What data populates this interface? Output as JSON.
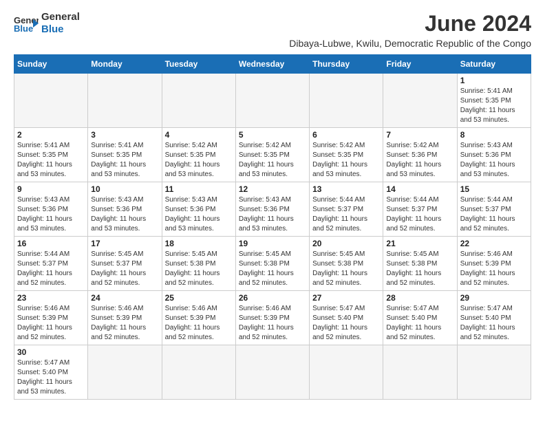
{
  "header": {
    "logo_general": "General",
    "logo_blue": "Blue",
    "month_year": "June 2024",
    "location": "Dibaya-Lubwe, Kwilu, Democratic Republic of the Congo"
  },
  "weekdays": [
    "Sunday",
    "Monday",
    "Tuesday",
    "Wednesday",
    "Thursday",
    "Friday",
    "Saturday"
  ],
  "weeks": [
    [
      {
        "day": "",
        "info": "",
        "empty": true
      },
      {
        "day": "",
        "info": "",
        "empty": true
      },
      {
        "day": "",
        "info": "",
        "empty": true
      },
      {
        "day": "",
        "info": "",
        "empty": true
      },
      {
        "day": "",
        "info": "",
        "empty": true
      },
      {
        "day": "",
        "info": "",
        "empty": true
      },
      {
        "day": "1",
        "info": "Sunrise: 5:41 AM\nSunset: 5:35 PM\nDaylight: 11 hours\nand 53 minutes.",
        "empty": false
      }
    ],
    [
      {
        "day": "2",
        "info": "Sunrise: 5:41 AM\nSunset: 5:35 PM\nDaylight: 11 hours\nand 53 minutes.",
        "empty": false
      },
      {
        "day": "3",
        "info": "Sunrise: 5:41 AM\nSunset: 5:35 PM\nDaylight: 11 hours\nand 53 minutes.",
        "empty": false
      },
      {
        "day": "4",
        "info": "Sunrise: 5:42 AM\nSunset: 5:35 PM\nDaylight: 11 hours\nand 53 minutes.",
        "empty": false
      },
      {
        "day": "5",
        "info": "Sunrise: 5:42 AM\nSunset: 5:35 PM\nDaylight: 11 hours\nand 53 minutes.",
        "empty": false
      },
      {
        "day": "6",
        "info": "Sunrise: 5:42 AM\nSunset: 5:35 PM\nDaylight: 11 hours\nand 53 minutes.",
        "empty": false
      },
      {
        "day": "7",
        "info": "Sunrise: 5:42 AM\nSunset: 5:36 PM\nDaylight: 11 hours\nand 53 minutes.",
        "empty": false
      },
      {
        "day": "8",
        "info": "Sunrise: 5:43 AM\nSunset: 5:36 PM\nDaylight: 11 hours\nand 53 minutes.",
        "empty": false
      }
    ],
    [
      {
        "day": "9",
        "info": "Sunrise: 5:43 AM\nSunset: 5:36 PM\nDaylight: 11 hours\nand 53 minutes.",
        "empty": false
      },
      {
        "day": "10",
        "info": "Sunrise: 5:43 AM\nSunset: 5:36 PM\nDaylight: 11 hours\nand 53 minutes.",
        "empty": false
      },
      {
        "day": "11",
        "info": "Sunrise: 5:43 AM\nSunset: 5:36 PM\nDaylight: 11 hours\nand 53 minutes.",
        "empty": false
      },
      {
        "day": "12",
        "info": "Sunrise: 5:43 AM\nSunset: 5:36 PM\nDaylight: 11 hours\nand 53 minutes.",
        "empty": false
      },
      {
        "day": "13",
        "info": "Sunrise: 5:44 AM\nSunset: 5:37 PM\nDaylight: 11 hours\nand 52 minutes.",
        "empty": false
      },
      {
        "day": "14",
        "info": "Sunrise: 5:44 AM\nSunset: 5:37 PM\nDaylight: 11 hours\nand 52 minutes.",
        "empty": false
      },
      {
        "day": "15",
        "info": "Sunrise: 5:44 AM\nSunset: 5:37 PM\nDaylight: 11 hours\nand 52 minutes.",
        "empty": false
      }
    ],
    [
      {
        "day": "16",
        "info": "Sunrise: 5:44 AM\nSunset: 5:37 PM\nDaylight: 11 hours\nand 52 minutes.",
        "empty": false
      },
      {
        "day": "17",
        "info": "Sunrise: 5:45 AM\nSunset: 5:37 PM\nDaylight: 11 hours\nand 52 minutes.",
        "empty": false
      },
      {
        "day": "18",
        "info": "Sunrise: 5:45 AM\nSunset: 5:38 PM\nDaylight: 11 hours\nand 52 minutes.",
        "empty": false
      },
      {
        "day": "19",
        "info": "Sunrise: 5:45 AM\nSunset: 5:38 PM\nDaylight: 11 hours\nand 52 minutes.",
        "empty": false
      },
      {
        "day": "20",
        "info": "Sunrise: 5:45 AM\nSunset: 5:38 PM\nDaylight: 11 hours\nand 52 minutes.",
        "empty": false
      },
      {
        "day": "21",
        "info": "Sunrise: 5:45 AM\nSunset: 5:38 PM\nDaylight: 11 hours\nand 52 minutes.",
        "empty": false
      },
      {
        "day": "22",
        "info": "Sunrise: 5:46 AM\nSunset: 5:39 PM\nDaylight: 11 hours\nand 52 minutes.",
        "empty": false
      }
    ],
    [
      {
        "day": "23",
        "info": "Sunrise: 5:46 AM\nSunset: 5:39 PM\nDaylight: 11 hours\nand 52 minutes.",
        "empty": false
      },
      {
        "day": "24",
        "info": "Sunrise: 5:46 AM\nSunset: 5:39 PM\nDaylight: 11 hours\nand 52 minutes.",
        "empty": false
      },
      {
        "day": "25",
        "info": "Sunrise: 5:46 AM\nSunset: 5:39 PM\nDaylight: 11 hours\nand 52 minutes.",
        "empty": false
      },
      {
        "day": "26",
        "info": "Sunrise: 5:46 AM\nSunset: 5:39 PM\nDaylight: 11 hours\nand 52 minutes.",
        "empty": false
      },
      {
        "day": "27",
        "info": "Sunrise: 5:47 AM\nSunset: 5:40 PM\nDaylight: 11 hours\nand 52 minutes.",
        "empty": false
      },
      {
        "day": "28",
        "info": "Sunrise: 5:47 AM\nSunset: 5:40 PM\nDaylight: 11 hours\nand 52 minutes.",
        "empty": false
      },
      {
        "day": "29",
        "info": "Sunrise: 5:47 AM\nSunset: 5:40 PM\nDaylight: 11 hours\nand 52 minutes.",
        "empty": false
      }
    ],
    [
      {
        "day": "30",
        "info": "Sunrise: 5:47 AM\nSunset: 5:40 PM\nDaylight: 11 hours\nand 53 minutes.",
        "empty": false
      },
      {
        "day": "",
        "info": "",
        "empty": true
      },
      {
        "day": "",
        "info": "",
        "empty": true
      },
      {
        "day": "",
        "info": "",
        "empty": true
      },
      {
        "day": "",
        "info": "",
        "empty": true
      },
      {
        "day": "",
        "info": "",
        "empty": true
      },
      {
        "day": "",
        "info": "",
        "empty": true
      }
    ]
  ]
}
